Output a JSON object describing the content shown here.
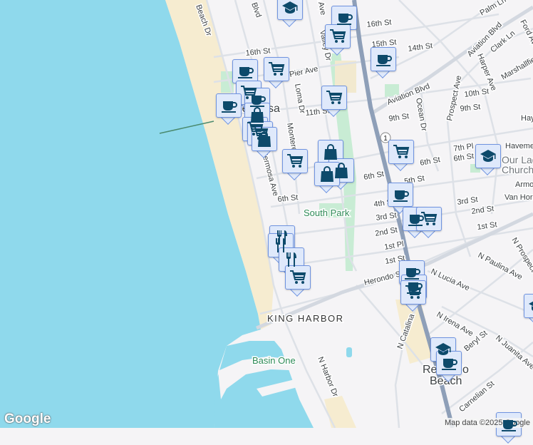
{
  "map": {
    "labels": {
      "beach_dr": "Beach Dr",
      "blvd": "Blvd",
      "e_ave": "e Ave",
      "valley_dr": "Valley Dr",
      "st16_a": "16th St",
      "st15": "15th St",
      "st14": "14th St",
      "st16_b": "16th St",
      "pier_ave": "Pier Ave",
      "loma_dr": "Loma Dr",
      "aviation_a": "Aviation Blvd",
      "aviation_b": "Aviation Blvd",
      "palm_ln": "Palm Ln",
      "clark_ln": "Clark Ln",
      "ford_ave": "Ford Ave",
      "harper_ave": "Harper Ave",
      "marshallfield": "Marshallfie",
      "st10": "10th St",
      "st9_a": "9th St",
      "hay": "Hay",
      "prospect_ave": "Prospect Ave",
      "ocean_dr": "Ocean Dr",
      "st11": "11th St",
      "st9_b": "9th St",
      "hermosa": "Hermosa",
      "monterey": "Monterey",
      "hermosa_ave": "Hermosa Ave",
      "st6_a": "6th St",
      "st6_b": "6th St",
      "st5": "5th St",
      "pl7": "7th Pl",
      "st6_c": "6th St",
      "havemeyer": "Havemeyer",
      "church_1": "Our Lady",
      "church_2": "Church",
      "armour": "Armour",
      "van_horne": "Van Horne",
      "st3_a": "3rd St",
      "st2_a": "2nd St",
      "st1_a": "1st St",
      "st4": "4th St",
      "st3_b": "3rd St",
      "st2_b": "2nd St",
      "pl1": "1st Pl",
      "st1_b": "1st St",
      "st6_d": "6th St",
      "south_park": "South Park",
      "herondo": "Herondo St",
      "n_lucia": "N Lucia Ave",
      "n_paulina": "N Paulina Ave",
      "n_prospect": "N Prospect",
      "n_irena": "N Irena Ave",
      "beryl": "Beryl St",
      "n_juanita": "N Juanita Ave",
      "n_catalina": "N Catalina",
      "carnelian": "Carnelian St",
      "king_harbor": "KING HARBOR",
      "basin_one": "Basin One",
      "n_harbor_dr": "N Harbor Dr",
      "redondo_1": "Redondo",
      "redondo_2": "Beach",
      "route_1": "1"
    },
    "markers": [
      {
        "type": "school-icon"
      },
      {
        "type": "coffee-icon"
      },
      {
        "type": "cart-icon"
      },
      {
        "type": "coffee-icon"
      },
      {
        "type": "coffee-icon"
      },
      {
        "type": "cart-icon"
      },
      {
        "type": "cart-icon"
      },
      {
        "type": "coffee-icon"
      },
      {
        "type": "coffee-icon"
      },
      {
        "type": "bag-icon"
      },
      {
        "type": "cart-icon"
      },
      {
        "type": "cart-icon"
      },
      {
        "type": "cart-icon"
      },
      {
        "type": "bag-icon"
      },
      {
        "type": "cart-icon"
      },
      {
        "type": "bag-icon"
      },
      {
        "type": "bag-icon"
      },
      {
        "type": "bag-icon"
      },
      {
        "type": "cart-icon"
      },
      {
        "type": "school-icon"
      },
      {
        "type": "coffee-icon"
      },
      {
        "type": "coffee-icon"
      },
      {
        "type": "cart-icon"
      },
      {
        "type": "restaurant-icon"
      },
      {
        "type": "restaurant-icon"
      },
      {
        "type": "restaurant-icon"
      },
      {
        "type": "cart-icon"
      },
      {
        "type": "coffee-icon"
      },
      {
        "type": "coffee-icon"
      },
      {
        "type": "cart-icon"
      },
      {
        "type": "school-icon"
      },
      {
        "type": "coffee-icon"
      },
      {
        "type": "school-icon"
      },
      {
        "type": "coffee-icon"
      }
    ],
    "colors": {
      "water": "#8fd9ec",
      "sand": "#f6ecd0",
      "land": "#f5f4f6",
      "highway": "#8e9fb8",
      "marker_icon": "#0d4a6b",
      "park": "#c8ecd4"
    }
  },
  "footer": {
    "logo": "Google",
    "attribution": "Map data ©2025 Google"
  }
}
